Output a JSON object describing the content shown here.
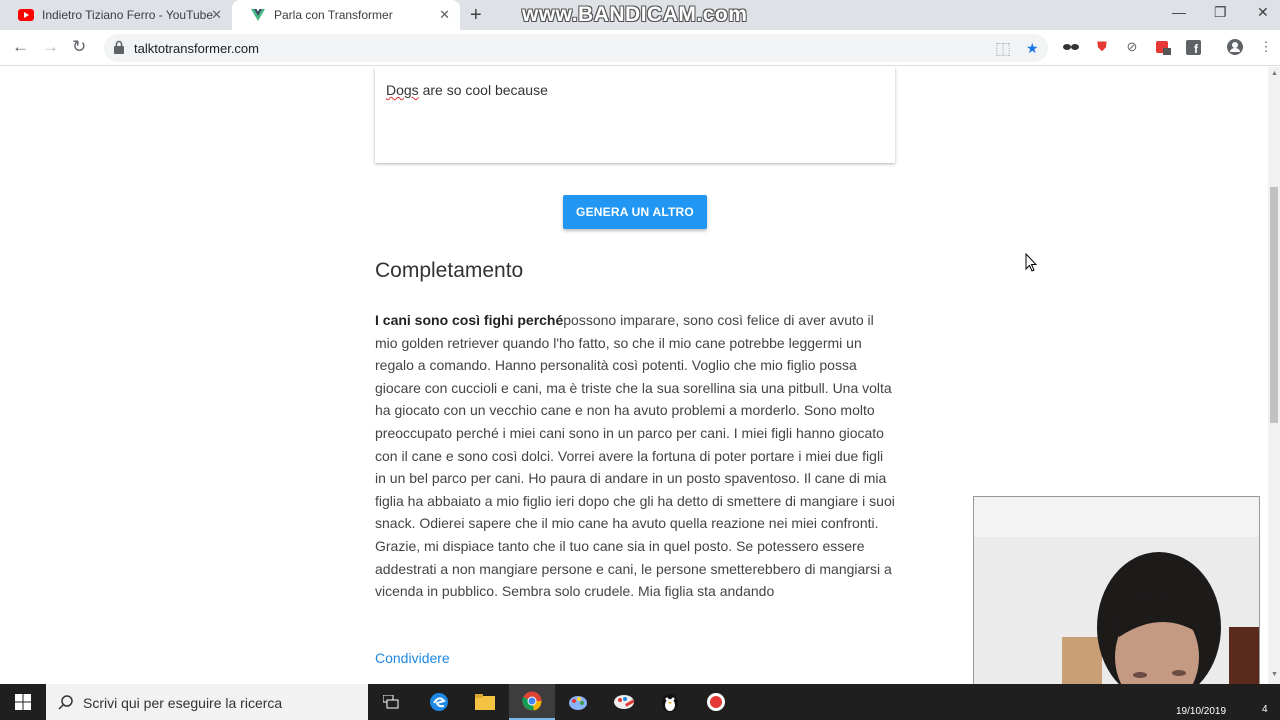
{
  "browser": {
    "tabs": [
      {
        "title": "Indietro Tiziano Ferro - YouTube",
        "active": false,
        "icon": "youtube-icon"
      },
      {
        "title": "Parla con Transformer",
        "active": true,
        "icon": "vue-icon"
      }
    ],
    "url": "talktotransformer.com",
    "watermark": "www.BANDICAM.com"
  },
  "page": {
    "prompt_text_a": "Dogs",
    "prompt_text_b": " are so cool because",
    "generate_button": "GENERA UN ALTRO",
    "heading": "Completamento",
    "completion_bold": "I cani sono così fighi perché",
    "completion_text": "possono imparare, sono così felice di aver avuto il mio golden retriever quando l'ho fatto, so che il mio cane potrebbe leggermi un regalo a comando. Hanno personalità così potenti. Voglio che mio figlio possa giocare con cuccioli e cani, ma è triste che la sua sorellina sia una pitbull. Una volta ha giocato con un vecchio cane e non ha avuto problemi a morderlo. Sono molto preoccupato perché i miei cani sono in un parco per cani. I miei figli hanno giocato con il cane e sono così dolci. Vorrei avere la fortuna di poter portare i miei due figli in un bel parco per cani. Ho paura di andare in un posto spaventoso. Il cane di mia figlia ha abbaiato a mio figlio ieri dopo che gli ha detto di smettere di mangiare i suoi snack. Odierei sapere che il mio cane ha avuto quella reazione nei miei confronti. Grazie, mi dispiace tanto che il tuo cane sia in quel posto. Se potessero essere addestrati a non mangiare persone e cani, le persone smetterebbero di mangiarsi a vicenda in pubblico. Sembra solo crudele. Mia figlia sta andando",
    "share_link": "Condividere"
  },
  "taskbar": {
    "search_placeholder": "Scrivi qui per eseguire la ricerca",
    "date": "19/10/2019",
    "notification_count": "4"
  },
  "colors": {
    "accent": "#2196f3",
    "link": "#1e88e5",
    "taskbar": "#1f1f1f"
  }
}
